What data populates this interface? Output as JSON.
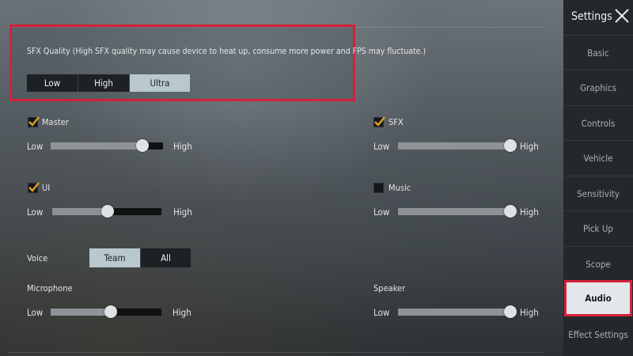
{
  "sidebar": {
    "title": "Settings",
    "items": [
      {
        "label": "Basic"
      },
      {
        "label": "Graphics"
      },
      {
        "label": "Controls"
      },
      {
        "label": "Vehicle"
      },
      {
        "label": "Sensitivity"
      },
      {
        "label": "Pick Up"
      },
      {
        "label": "Scope"
      },
      {
        "label": "Audio"
      },
      {
        "label": "Effect Settings"
      }
    ],
    "active": "Audio"
  },
  "sfx_quality": {
    "label": "SFX Quality (High SFX quality may cause device to heat up, consume more power and FPS may fluctuate.)",
    "options": [
      "Low",
      "High",
      "Ultra"
    ],
    "selected": "Ultra"
  },
  "audio": {
    "master": {
      "label": "Master",
      "checked": true,
      "low": "Low",
      "high": "High",
      "value": 0.82
    },
    "sfx": {
      "label": "SFX",
      "checked": true,
      "low": "Low",
      "high": "High",
      "value": 1.0
    },
    "ui": {
      "label": "UI",
      "checked": true,
      "low": "Low",
      "high": "High",
      "value": 0.51
    },
    "music": {
      "label": "Music",
      "checked": false,
      "low": "Low",
      "high": "High",
      "value": 1.0
    },
    "voice": {
      "label": "Voice",
      "options": [
        "Team",
        "All"
      ],
      "selected": "Team"
    },
    "microphone": {
      "label": "Microphone",
      "low": "Low",
      "high": "High",
      "value": 0.54
    },
    "speaker": {
      "label": "Speaker",
      "low": "Low",
      "high": "High",
      "value": 1.0
    }
  },
  "colors": {
    "highlight": "#d61f3b",
    "active_segment": "#b9c8cf",
    "checkmark": "#e0a426"
  }
}
